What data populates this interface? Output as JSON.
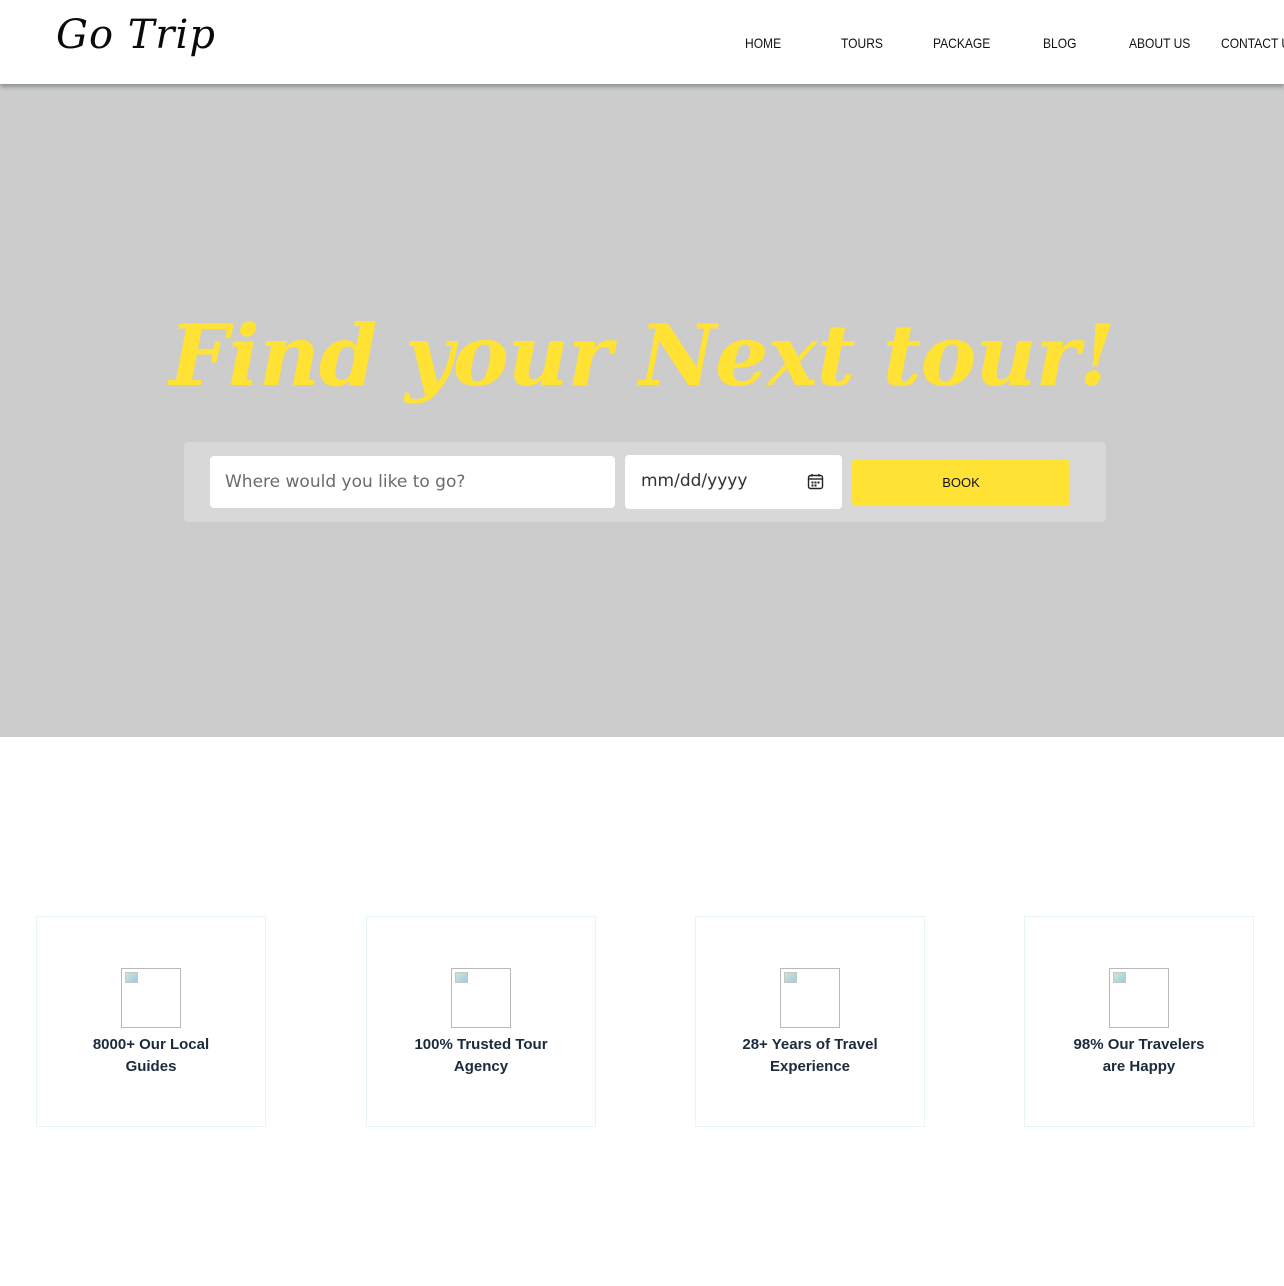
{
  "header": {
    "logo": "Go Trip",
    "nav": [
      {
        "label": "HOME"
      },
      {
        "label": "TOURS"
      },
      {
        "label": "PACKAGE"
      },
      {
        "label": "BLOG"
      },
      {
        "label": "ABOUT US"
      },
      {
        "label": "CONTACT US"
      }
    ]
  },
  "hero": {
    "title": "Find your Next tour!",
    "search": {
      "destination_placeholder": "Where would you like to go?",
      "date_placeholder": "mm/dd/yyyy",
      "date_icon": "calendar-icon",
      "book_label": "BOOK"
    }
  },
  "features": [
    {
      "icon": "broken-image-icon",
      "line1": "8000+ Our Local",
      "line2": "Guides"
    },
    {
      "icon": "broken-image-icon",
      "line1": "100% Trusted Tour",
      "line2": "Agency"
    },
    {
      "icon": "broken-image-icon",
      "line1": "28+ Years of Travel",
      "line2": "Experience"
    },
    {
      "icon": "broken-image-icon",
      "line1": "98% Our Travelers",
      "line2": "are Happy"
    }
  ],
  "colors": {
    "accent": "#ffe234",
    "hero_bg": "#cccccc",
    "feature_text": "#1b2a3c"
  }
}
